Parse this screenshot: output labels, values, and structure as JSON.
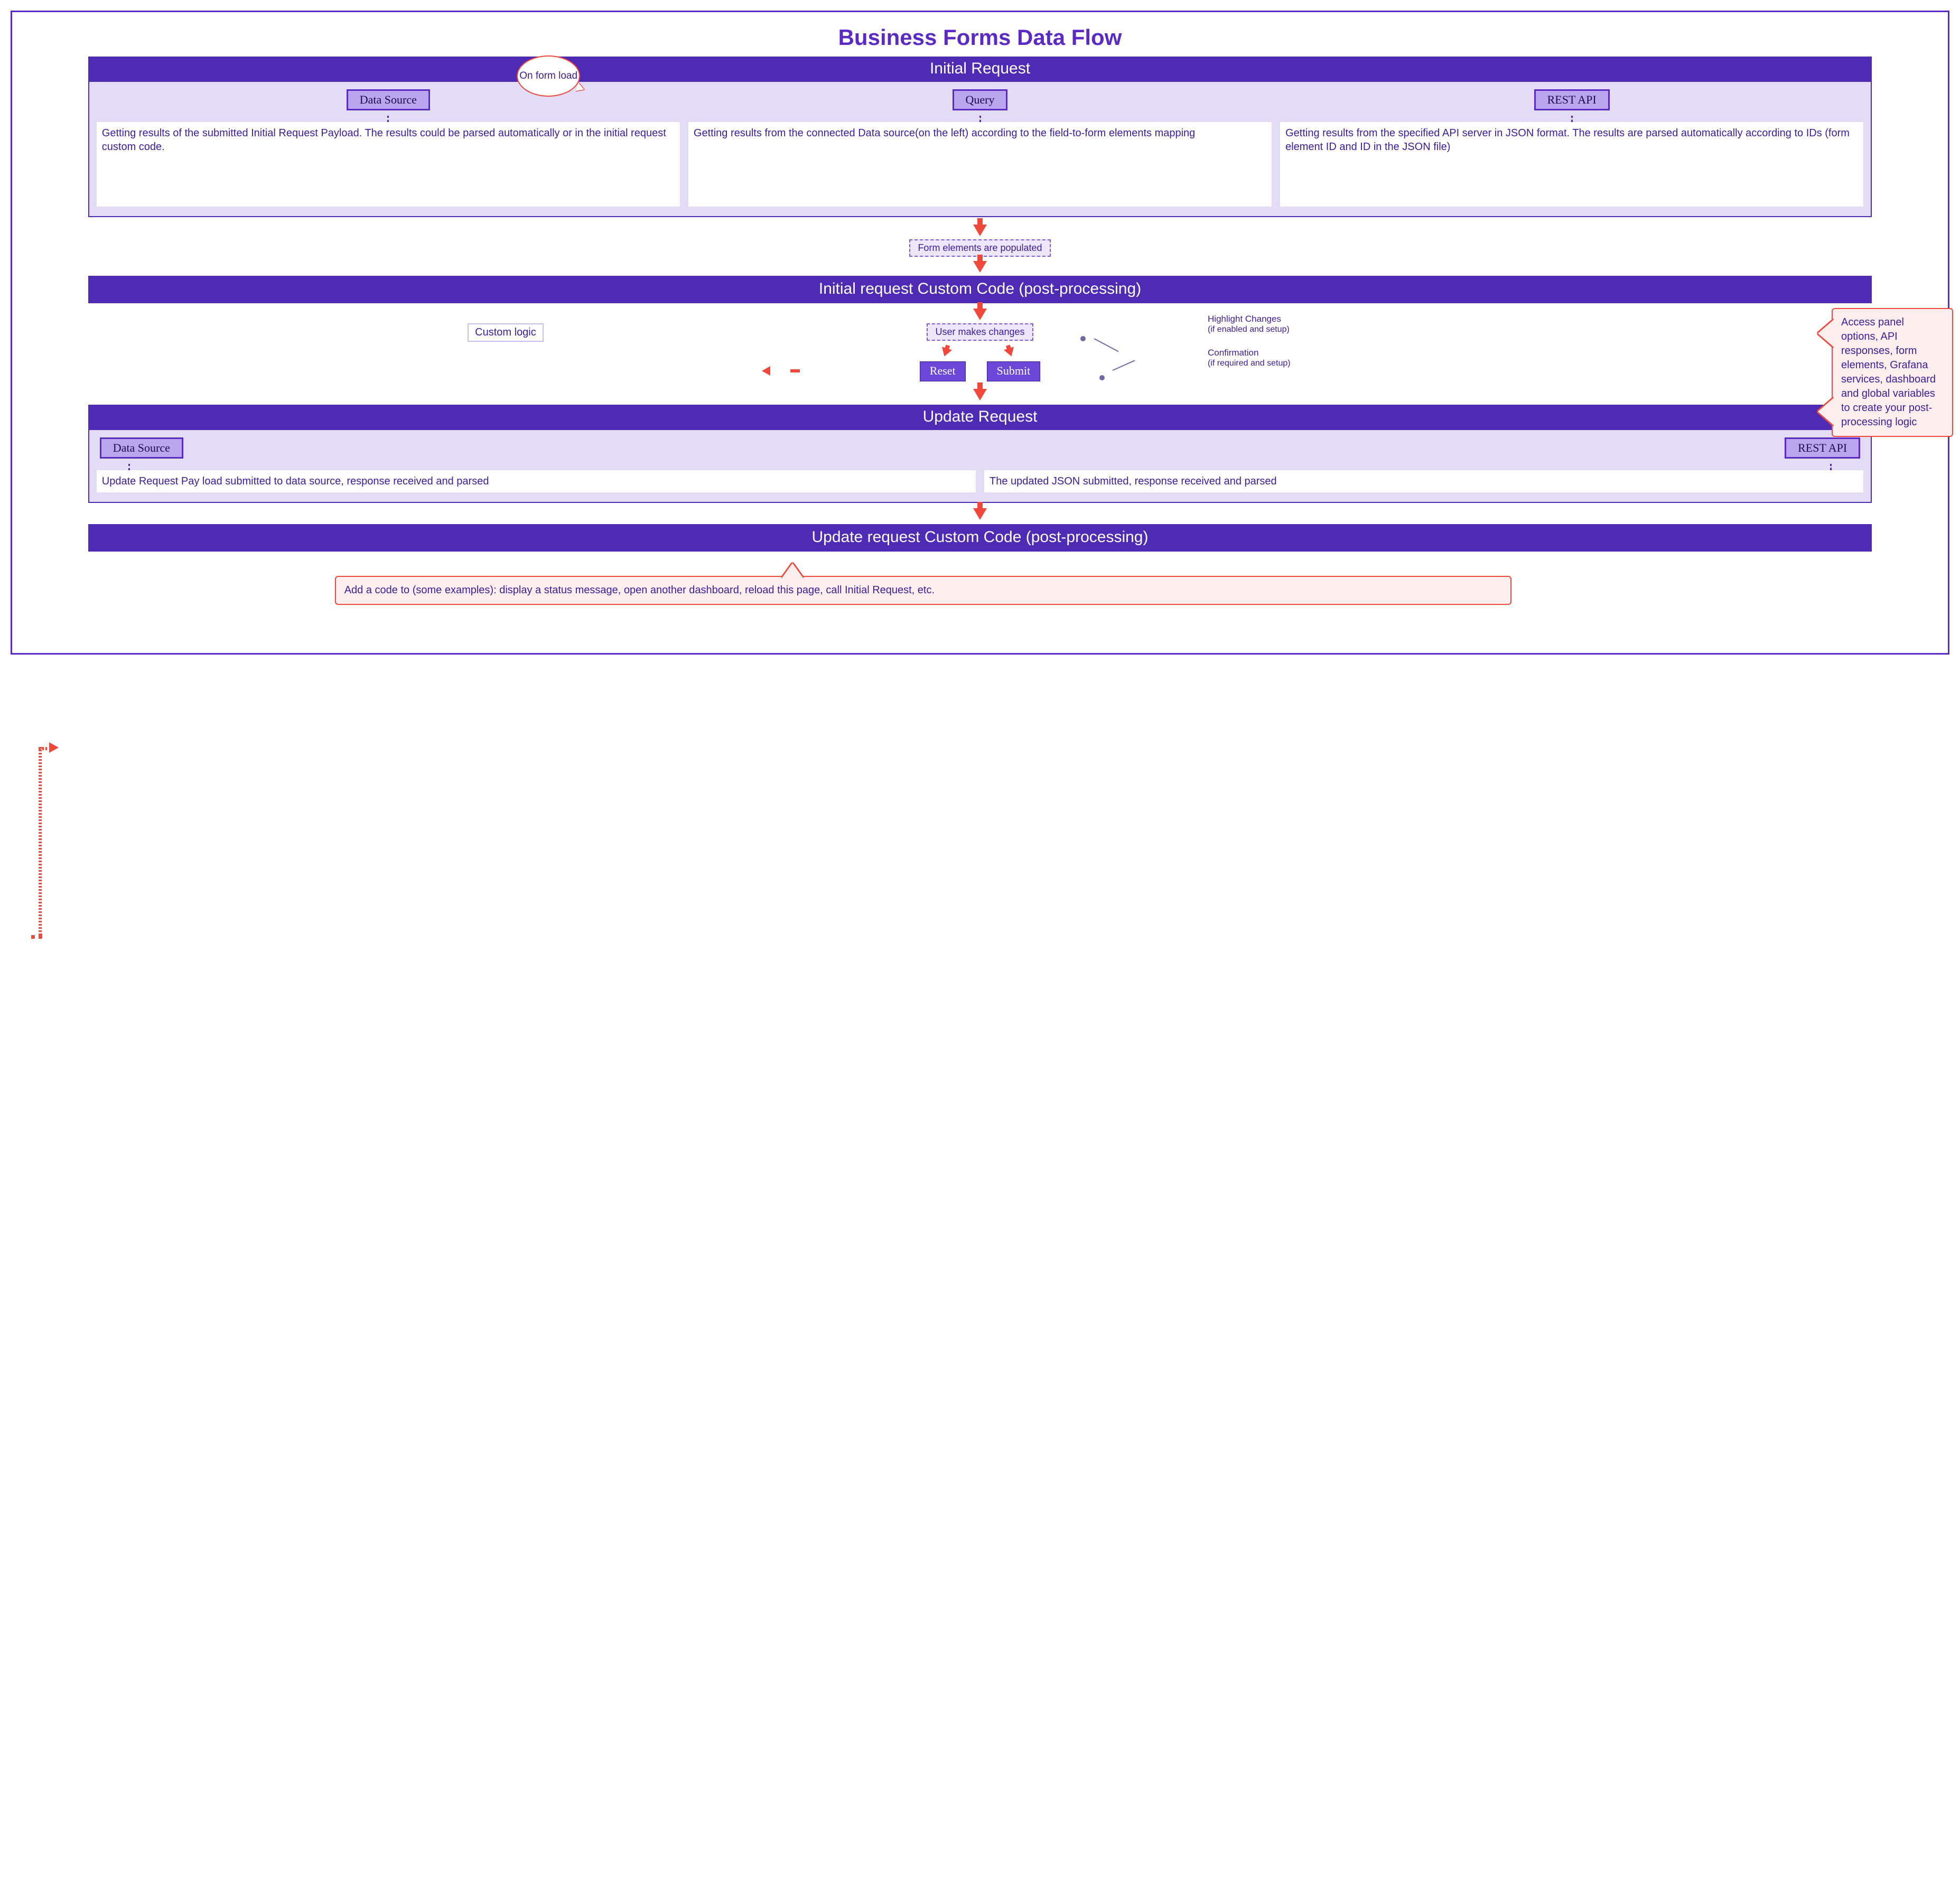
{
  "title": "Business Forms Data Flow",
  "onFormLoad": "On form load",
  "initialRequest": {
    "header": "Initial Request",
    "cols": [
      {
        "tab": "Data Source",
        "text": "Getting results of the submitted Initial Request Payload. The results could be parsed automatically or in the initial request custom code."
      },
      {
        "tab": "Query",
        "text": "Getting results from the connected Data source(on the left) according to the field-to-form elements mapping"
      },
      {
        "tab": "REST API",
        "text": "Getting results from the specified API server in JSON format. The results are parsed automatically according to IDs (form element ID and ID in the JSON file)"
      }
    ]
  },
  "chips": {
    "populated": "Form elements are populated",
    "userChanges": "User makes changes"
  },
  "bars": {
    "initialCC": "Initial request Custom Code (post-processing)",
    "updateCC": "Update request Custom Code (post-processing)"
  },
  "customLogic": "Custom logic",
  "buttons": {
    "reset": "Reset",
    "submit": "Submit"
  },
  "sideNotes": {
    "highlight": {
      "title": "Highlight Changes",
      "sub": "(if enabled and setup)"
    },
    "confirm": {
      "title": "Confirmation",
      "sub": "(if required and setup)"
    }
  },
  "updateRequest": {
    "header": "Update Request",
    "cols": [
      {
        "tab": "Data Source",
        "text": "Update Request Pay load submitted to data source, response received and parsed"
      },
      {
        "tab": "REST API",
        "text": "The updated JSON submitted, response received and parsed"
      }
    ]
  },
  "callouts": {
    "right": "Access panel options, API responses, form elements, Grafana services, dashboard and global variables to create your post-processing logic",
    "bottom": "Add a code to (some examples): display a status message, open another dashboard, reload this page, call Initial Request, etc."
  }
}
